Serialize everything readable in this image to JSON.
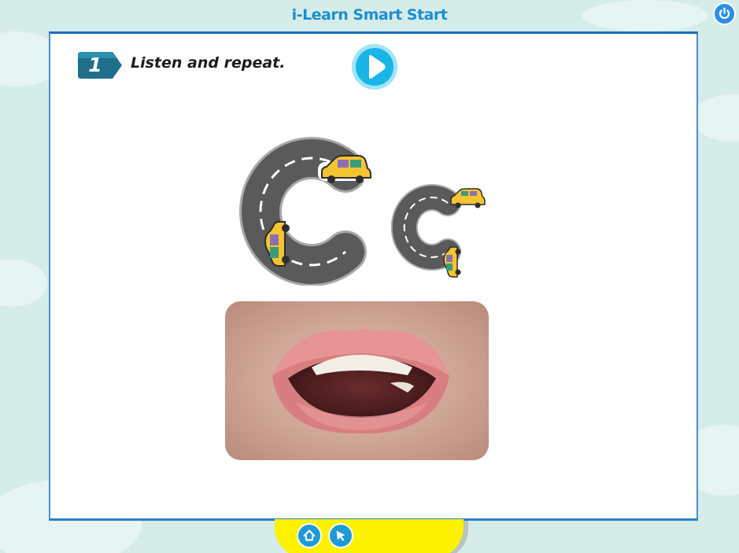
{
  "app": {
    "title": "i-Learn Smart Start"
  },
  "header": {
    "power_icon": "power-icon"
  },
  "activity": {
    "step_number": "1",
    "instruction": "Listen and repeat.",
    "play_icon": "play-icon",
    "letters": [
      "C",
      "c"
    ],
    "letter_art_icon": "letter-c-road-cars-illustration",
    "photo_icon": "open-mouth-photo"
  },
  "footer": {
    "home_icon": "home-icon",
    "pointer_icon": "pointer-arrow-icon"
  },
  "colors": {
    "title_blue": "#1b8fd0",
    "panel_border": "#1b6fb8",
    "step_badge": "#1f6f8b",
    "play_cyan": "#19b5e6",
    "footer_yellow": "#fff200",
    "background": "#d6ece9"
  }
}
